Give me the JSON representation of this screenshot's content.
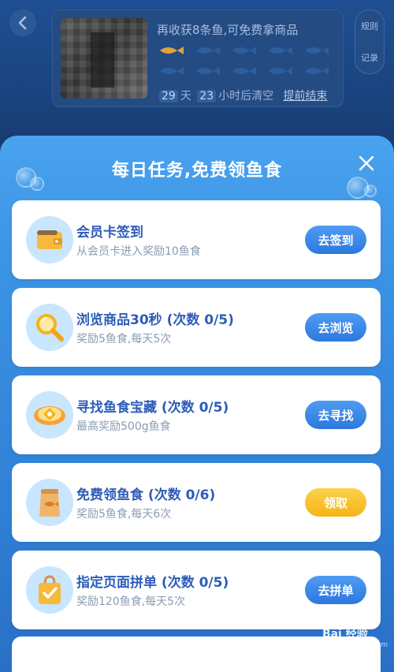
{
  "header": {
    "rules_label": "规则",
    "records_label": "记录"
  },
  "fish_card": {
    "title": "再收获8条鱼,可免费拿商品",
    "fish_collected": 1,
    "fish_total": 10,
    "days": "29",
    "days_unit": "天",
    "hours": "23",
    "hours_unit": "小时后清空",
    "end_early_label": "提前结束"
  },
  "modal": {
    "title": "每日任务,免费领鱼食",
    "tasks": [
      {
        "name": "会员卡签到",
        "desc": "从会员卡进入奖励10鱼食",
        "button": "去签到",
        "button_color": "#2d78dd",
        "icon": "wallet-icon"
      },
      {
        "name": "浏览商品30秒 (次数 0/5)",
        "desc": "奖励5鱼食,每天5次",
        "button": "去浏览",
        "button_color": "#2d78dd",
        "icon": "magnifier-icon"
      },
      {
        "name": "寻找鱼食宝藏 (次数 0/5)",
        "desc": "最高奖励500g鱼食",
        "button": "去寻找",
        "button_color": "#2d78dd",
        "icon": "treasure-icon"
      },
      {
        "name": "免费领鱼食 (次数 0/6)",
        "desc": "奖励5鱼食,每天6次",
        "button": "领取",
        "button_color": "#f5b416",
        "icon": "fish-food-bag-icon"
      },
      {
        "name": "指定页面拼单 (次数 0/5)",
        "desc": "奖励120鱼食,每天5次",
        "button": "去拼单",
        "button_color": "#2d78dd",
        "icon": "shopping-bag-icon"
      }
    ]
  },
  "watermark": {
    "text": "Bai 经验",
    "sub": "jingyan.baidu.com"
  }
}
